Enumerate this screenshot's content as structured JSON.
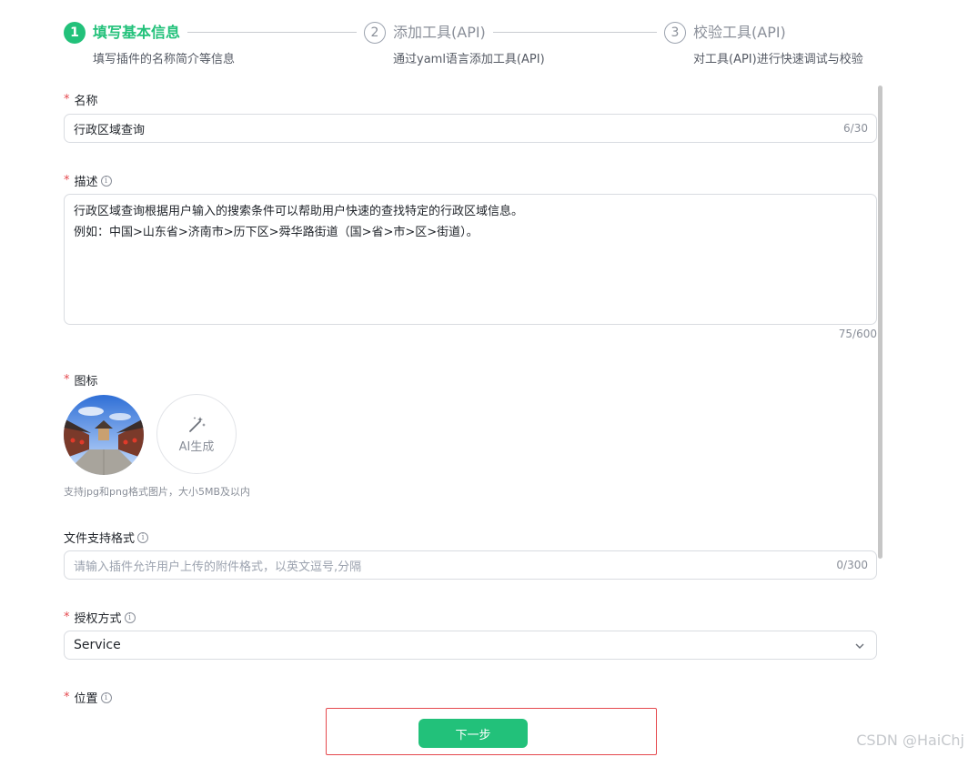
{
  "steps": [
    {
      "number": "1",
      "title": "填写基本信息",
      "description": "填写插件的名称简介等信息",
      "state": "active"
    },
    {
      "number": "2",
      "title": "添加工具(API)",
      "description": "通过yaml语言添加工具(API)",
      "state": "inactive"
    },
    {
      "number": "3",
      "title": "校验工具(API)",
      "description": "对工具(API)进行快速调试与校验",
      "state": "inactive"
    }
  ],
  "form": {
    "required_mark": "*",
    "info_glyph": "i",
    "name": {
      "label": "名称",
      "value": "行政区域查询",
      "counter": "6/30"
    },
    "description": {
      "label": "描述",
      "lines": [
        "行政区域查询根据用户输入的搜索条件可以帮助用户快速的查找特定的行政区域信息。",
        "例如：中国>山东省>济南市>历下区>舜华路街道（国>省>市>区>街道）。"
      ],
      "counter": "75/600"
    },
    "icon": {
      "label": "图标",
      "ai_button": "AI生成",
      "hint": "支持jpg和png格式图片，大小5MB及以内",
      "ai_icon": "magic-wand-icon"
    },
    "file_formats": {
      "label": "文件支持格式",
      "placeholder": "请输入插件允许用户上传的附件格式，以英文逗号,分隔",
      "counter": "0/300"
    },
    "auth": {
      "label": "授权方式",
      "value": "Service"
    },
    "location": {
      "label": "位置"
    }
  },
  "footer": {
    "next_button": "下一步"
  },
  "watermark": "CSDN @HaiChj",
  "colors": {
    "accent": "#22c17a",
    "required": "#e5484d",
    "highlight": "#e5484d"
  }
}
